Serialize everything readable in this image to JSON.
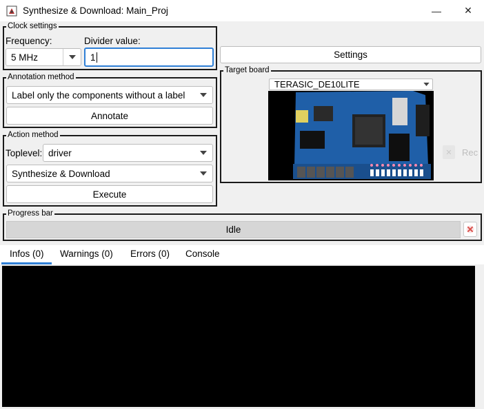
{
  "window": {
    "title": "Synthesize & Download: Main_Proj",
    "minimize_icon": "—",
    "close_icon": "✕"
  },
  "clock_settings": {
    "group_title": "Clock settings",
    "frequency_label": "Frequency:",
    "frequency_value": "5 MHz",
    "divider_label": "Divider value:",
    "divider_value": "1"
  },
  "settings_button": "Settings",
  "target_board": {
    "group_title": "Target board",
    "selected": "TERASIC_DE10LITE"
  },
  "annotation": {
    "group_title": "Annotation method",
    "mode": "Label only the components without a label",
    "button": "Annotate"
  },
  "action": {
    "group_title": "Action method",
    "toplevel_label": "Toplevel:",
    "toplevel_value": "driver",
    "action_value": "Synthesize & Download",
    "button": "Execute"
  },
  "progress": {
    "group_title": "Progress bar",
    "status": "Idle",
    "fraction": 0
  },
  "tabs": [
    {
      "label": "Infos (0)",
      "active": true
    },
    {
      "label": "Warnings (0)",
      "active": false
    },
    {
      "label": "Errors (0)",
      "active": false
    },
    {
      "label": "Console",
      "active": false
    }
  ],
  "background_partial": {
    "text": "Rec"
  },
  "colors": {
    "accent": "#2e7fd6",
    "cancel_icon": "#d9534f",
    "console_bg": "#000000"
  }
}
